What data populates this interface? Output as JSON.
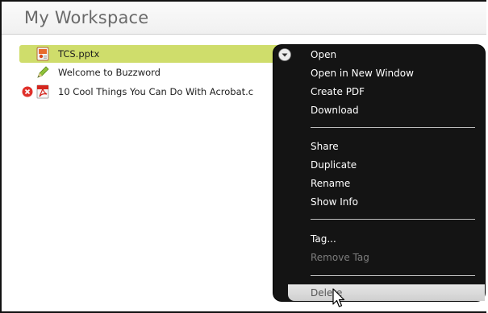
{
  "header": {
    "title": "My Workspace"
  },
  "files": [
    {
      "name": "TCS.pptx",
      "icon": "powerpoint-file-icon",
      "selected": true,
      "error": false
    },
    {
      "name": "Welcome to Buzzword",
      "icon": "buzzword-document-icon",
      "selected": false,
      "error": false
    },
    {
      "name": "10 Cool Things You Can Do With Acrobat.c",
      "icon": "pdf-file-icon",
      "selected": false,
      "error": true
    }
  ],
  "context_menu": {
    "items": [
      {
        "label": "Open",
        "enabled": true
      },
      {
        "label": "Open in New Window",
        "enabled": true
      },
      {
        "label": "Create PDF",
        "enabled": true
      },
      {
        "label": "Download",
        "enabled": true
      },
      {
        "label": "Share",
        "enabled": true
      },
      {
        "label": "Duplicate",
        "enabled": true
      },
      {
        "label": "Rename",
        "enabled": true
      },
      {
        "label": "Show Info",
        "enabled": true
      },
      {
        "label": "Tag...",
        "enabled": true
      },
      {
        "label": "Remove Tag",
        "enabled": false
      },
      {
        "label": "Delete",
        "enabled": true,
        "hovered": true
      }
    ]
  },
  "colors": {
    "selection": "#cfdd6b",
    "menu_background": "#141414",
    "error_red": "#e0302a"
  }
}
